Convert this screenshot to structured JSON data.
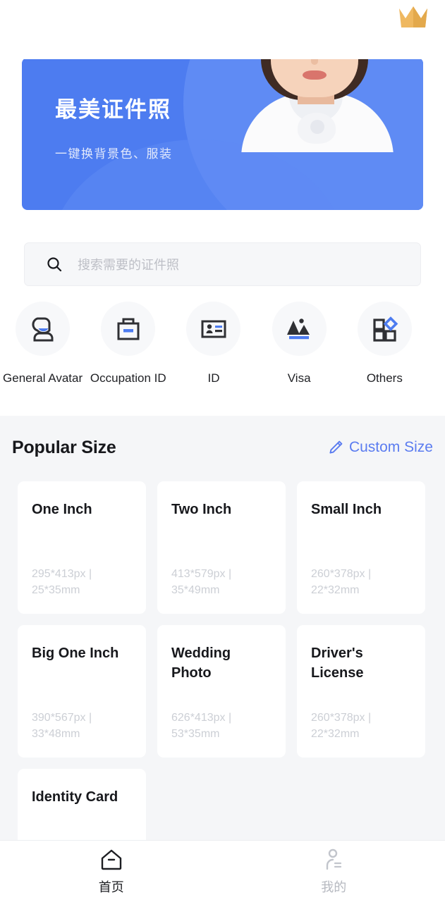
{
  "colors": {
    "brand_blue": "#4d7cf0",
    "link_blue": "#5b7cf0",
    "crown_gold": "#efb860",
    "section_bg": "#f5f6f8",
    "card_bg": "#ffffff",
    "spec_gray": "#cccfd5"
  },
  "topbar": {
    "crown_icon": "crown-icon"
  },
  "hero": {
    "title": "最美证件照",
    "subtitle": "一键换背景色、服装",
    "photo_alt": "portrait-photo"
  },
  "search": {
    "icon": "search-icon",
    "placeholder": "搜索需要的证件照",
    "value": ""
  },
  "categories": [
    {
      "label": "General Avatar",
      "icon": "avatar-icon"
    },
    {
      "label": "Occupation ID",
      "icon": "briefcase-icon"
    },
    {
      "label": "ID",
      "icon": "id-card-icon"
    },
    {
      "label": "Visa",
      "icon": "landscape-icon"
    },
    {
      "label": "Others",
      "icon": "grid-icon"
    }
  ],
  "popular": {
    "title": "Popular Size",
    "custom_label": "Custom Size",
    "custom_icon": "pencil-icon",
    "cards": [
      {
        "title": "One Inch",
        "spec": "295*413px | 25*35mm"
      },
      {
        "title": "Two Inch",
        "spec": "413*579px | 35*49mm"
      },
      {
        "title": "Small Inch",
        "spec": "260*378px | 22*32mm"
      },
      {
        "title": "Big One Inch",
        "spec": "390*567px | 33*48mm"
      },
      {
        "title": "Wedding Photo",
        "spec": "626*413px | 53*35mm"
      },
      {
        "title": "Driver's License",
        "spec": "260*378px | 22*32mm"
      },
      {
        "title": "Identity Card",
        "spec": ""
      }
    ]
  },
  "tabbar": [
    {
      "label": "首页",
      "icon": "home-icon",
      "active": true
    },
    {
      "label": "我的",
      "icon": "user-icon",
      "active": false
    }
  ]
}
